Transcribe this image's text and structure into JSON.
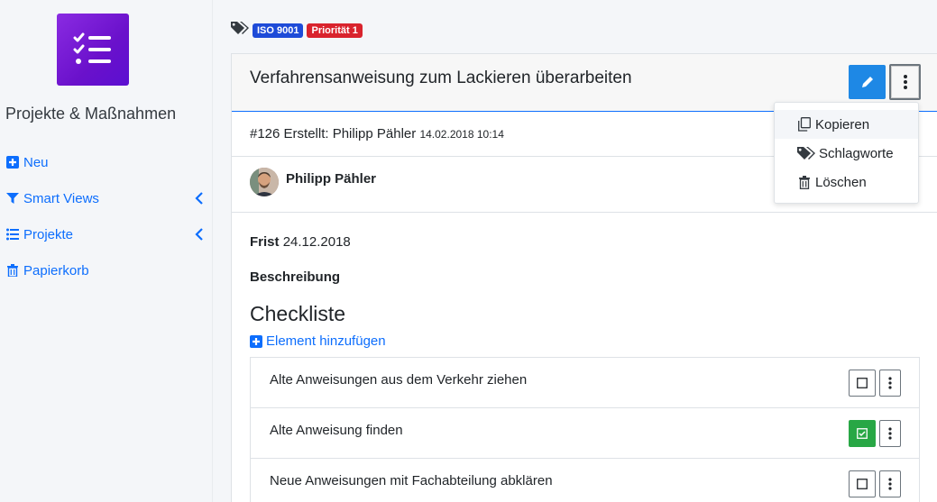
{
  "sidebar": {
    "app_title": "Projekte & Maßnahmen",
    "logo_icon": "checklist-icon",
    "items": [
      {
        "label": "Neu",
        "icon": "plus-square-icon",
        "has_chevron": false
      },
      {
        "label": "Smart Views",
        "icon": "filter-icon",
        "has_chevron": true
      },
      {
        "label": "Projekte",
        "icon": "list-icon",
        "has_chevron": true
      },
      {
        "label": "Papierkorb",
        "icon": "trash-icon",
        "has_chevron": false
      }
    ]
  },
  "tags": {
    "icon": "tags-icon",
    "badges": [
      {
        "label": "ISO 9001",
        "color": "#1e4bd8"
      },
      {
        "label": "Priorität 1",
        "color": "#d9232d"
      }
    ]
  },
  "task": {
    "title": "Verfahrensanweisung zum Lackieren überarbeiten",
    "meta": "#126 Erstellt: Philipp Pähler",
    "meta_date": "14.02.2018 10:14",
    "author": "Philipp Pähler",
    "frist_label": "Frist",
    "frist_value": "24.12.2018",
    "description_label": "Beschreibung",
    "checklist_heading": "Checkliste",
    "add_element_label": "Element hinzufügen",
    "checklist": [
      {
        "text": "Alte Anweisungen aus dem Verkehr ziehen",
        "checked": false
      },
      {
        "text": "Alte Anweisung finden",
        "checked": true
      },
      {
        "text": "Neue Anweisungen mit Fachabteilung abklären",
        "checked": false
      }
    ]
  },
  "dropdown": {
    "items": [
      {
        "label": "Kopieren",
        "icon": "copy-icon"
      },
      {
        "label": "Schlagworte",
        "icon": "tags-icon"
      },
      {
        "label": "Löschen",
        "icon": "trash-icon"
      }
    ]
  },
  "colors": {
    "accent": "#0d6efd",
    "edit_button": "#1e88e5",
    "checked": "#28a745"
  }
}
